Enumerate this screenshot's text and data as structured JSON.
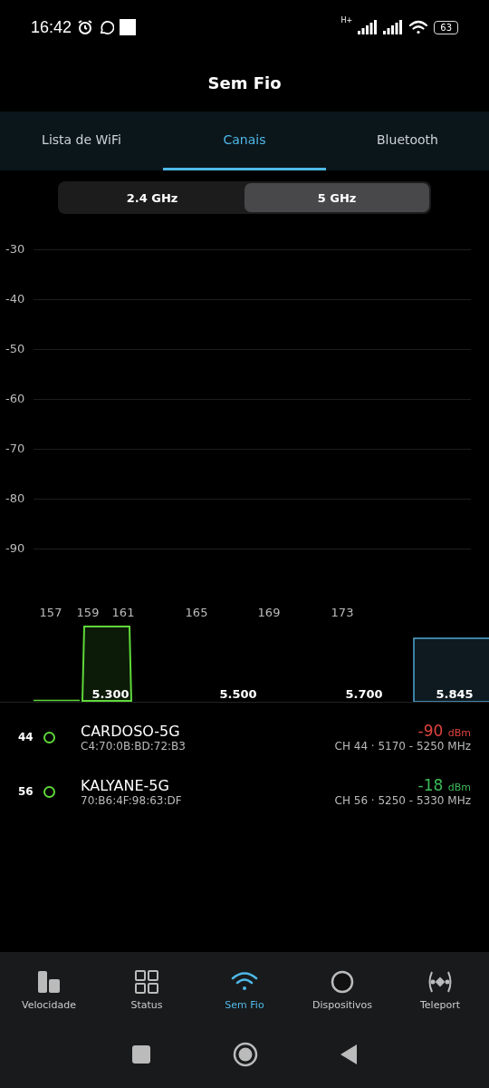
{
  "status_bar": {
    "time": "16:42",
    "network_type": "H+",
    "battery": "63"
  },
  "title": "Sem Fio",
  "tabs": [
    {
      "label": "Lista de WiFi",
      "selected": false
    },
    {
      "label": "Canais",
      "selected": true
    },
    {
      "label": "Bluetooth",
      "selected": false
    }
  ],
  "bands": [
    {
      "label": "2.4 GHz",
      "selected": false
    },
    {
      "label": "5 GHz",
      "selected": true
    }
  ],
  "chart": {
    "y_labels": [
      "-30",
      "-40",
      "-50",
      "-60",
      "-70",
      "-80",
      "-90"
    ],
    "channel_labels": [
      "157",
      "159",
      "161",
      "165",
      "169",
      "173"
    ],
    "frequency_labels": [
      "5.300",
      "5.500",
      "5.700",
      "5.845"
    ]
  },
  "networks": [
    {
      "channel": "44",
      "color": "#5fd83a",
      "name": "CARDOSO-5G",
      "mac": "C4:70:0B:BD:72:B3",
      "signal": {
        "value": "-90",
        "unit": "dBm",
        "color": "#e0443e"
      },
      "details": "CH 44 · 5170 - 5250 MHz"
    },
    {
      "channel": "56",
      "color": "#5fd83a",
      "name": "KALYANE-5G",
      "mac": "70:B6:4F:98:63:DF",
      "signal": {
        "value": "-18",
        "unit": "dBm",
        "color": "#3dbb5a"
      },
      "details": "CH 56 · 5250 - 5330 MHz"
    }
  ],
  "nav": [
    {
      "kind": "speed",
      "label": "Velocidade",
      "selected": false
    },
    {
      "kind": "status",
      "label": "Status",
      "selected": false
    },
    {
      "kind": "wifi",
      "label": "Sem Fio",
      "selected": true
    },
    {
      "kind": "devices",
      "label": "Dispositivos",
      "selected": false
    },
    {
      "kind": "teleport",
      "label": "Teleport",
      "selected": false
    }
  ]
}
